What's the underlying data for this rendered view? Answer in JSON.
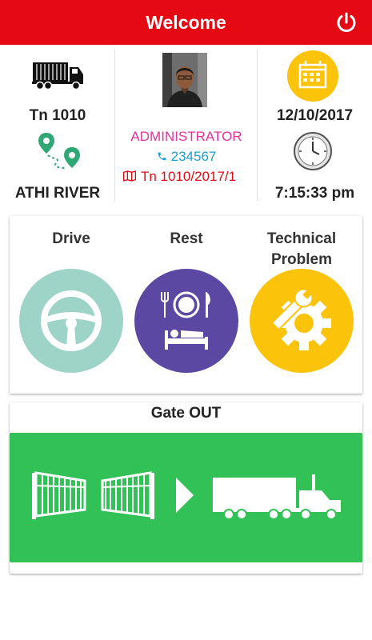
{
  "header": {
    "title": "Welcome",
    "power_icon": "power-icon",
    "color": "#e50914"
  },
  "vehicle": {
    "number": "Tn 1010",
    "location": "ATHI RIVER",
    "truck_icon": "truck-icon",
    "route_icon": "route-pin-icon"
  },
  "profile": {
    "role": "ADMINISTRATOR",
    "phone": "234567",
    "trip": "Tn 1010/2017/1",
    "role_color": "#e6329b",
    "phone_color": "#1a9fd6",
    "trip_color": "#e50914"
  },
  "datetime": {
    "date": "12/10/2017",
    "time": "7:15:33 pm"
  },
  "actions": [
    {
      "label": "Drive",
      "icon": "steering-wheel-icon",
      "color": "#9ed3c7"
    },
    {
      "label": "Rest",
      "icon": "dining-sleep-icon",
      "color": "#5b48a2"
    },
    {
      "label": "Technical\nProblem",
      "icon": "gear-wrench-icon",
      "color": "#fcc30b"
    }
  ],
  "gate": {
    "title": "Gate OUT",
    "color": "#32c156",
    "icon": "gate-truck-icon"
  }
}
